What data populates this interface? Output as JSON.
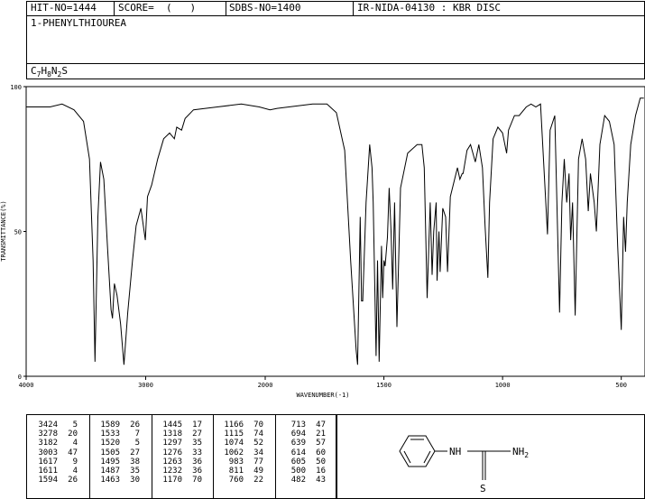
{
  "header": {
    "hit_no": "HIT-NO=1444",
    "score": "SCORE=  (   )",
    "sdbs_no": "SDBS-NO=1400",
    "ir_id": "IR-NIDA-04130 : KBR DISC",
    "compound_name": "1-PHENYLTHIOUREA",
    "formula": {
      "c": "C",
      "c_n": "7",
      "h": "H",
      "h_n": "8",
      "n": "N",
      "n_n": "2",
      "s": "S"
    }
  },
  "chart_data": {
    "type": "line",
    "xlabel": "WAVENUMBER(-1)",
    "ylabel": "TRANSMITTANCE(%)",
    "xlim": [
      4000,
      400
    ],
    "ylim": [
      0,
      100
    ],
    "x_ticks": [
      4000,
      3000,
      2000,
      1500,
      1000,
      500
    ],
    "y_ticks": [
      0,
      50,
      100
    ],
    "grid": false,
    "series": [
      {
        "points": [
          [
            4000,
            93
          ],
          [
            3800,
            93
          ],
          [
            3700,
            94
          ],
          [
            3600,
            92
          ],
          [
            3520,
            88
          ],
          [
            3470,
            75
          ],
          [
            3440,
            40
          ],
          [
            3424,
            5
          ],
          [
            3400,
            55
          ],
          [
            3378,
            74
          ],
          [
            3350,
            68
          ],
          [
            3320,
            45
          ],
          [
            3290,
            23
          ],
          [
            3278,
            20
          ],
          [
            3262,
            32
          ],
          [
            3240,
            28
          ],
          [
            3210,
            18
          ],
          [
            3182,
            4
          ],
          [
            3150,
            22
          ],
          [
            3110,
            40
          ],
          [
            3080,
            52
          ],
          [
            3040,
            58
          ],
          [
            3003,
            47
          ],
          [
            2985,
            62
          ],
          [
            2950,
            66
          ],
          [
            2900,
            75
          ],
          [
            2850,
            82
          ],
          [
            2800,
            84
          ],
          [
            2760,
            82
          ],
          [
            2740,
            86
          ],
          [
            2700,
            85
          ],
          [
            2670,
            89
          ],
          [
            2600,
            92
          ],
          [
            2400,
            93
          ],
          [
            2200,
            94
          ],
          [
            2050,
            93
          ],
          [
            1980,
            92
          ],
          [
            1950,
            92.5
          ],
          [
            1900,
            93
          ],
          [
            1800,
            94
          ],
          [
            1740,
            94
          ],
          [
            1700,
            91
          ],
          [
            1665,
            78
          ],
          [
            1640,
            40
          ],
          [
            1617,
            9
          ],
          [
            1611,
            4
          ],
          [
            1600,
            55
          ],
          [
            1594,
            26
          ],
          [
            1589,
            26
          ],
          [
            1575,
            60
          ],
          [
            1560,
            80
          ],
          [
            1550,
            72
          ],
          [
            1545,
            60
          ],
          [
            1533,
            7
          ],
          [
            1527,
            40
          ],
          [
            1520,
            5
          ],
          [
            1510,
            45
          ],
          [
            1505,
            27
          ],
          [
            1500,
            40
          ],
          [
            1495,
            38
          ],
          [
            1485,
            48
          ],
          [
            1478,
            65
          ],
          [
            1470,
            50
          ],
          [
            1463,
            30
          ],
          [
            1455,
            60
          ],
          [
            1445,
            17
          ],
          [
            1430,
            65
          ],
          [
            1400,
            77
          ],
          [
            1360,
            80
          ],
          [
            1340,
            80
          ],
          [
            1330,
            72
          ],
          [
            1318,
            27
          ],
          [
            1305,
            60
          ],
          [
            1297,
            35
          ],
          [
            1290,
            50
          ],
          [
            1280,
            60
          ],
          [
            1276,
            33
          ],
          [
            1268,
            50
          ],
          [
            1263,
            36
          ],
          [
            1252,
            58
          ],
          [
            1240,
            55
          ],
          [
            1232,
            36
          ],
          [
            1220,
            62
          ],
          [
            1190,
            72
          ],
          [
            1180,
            68
          ],
          [
            1170,
            70
          ],
          [
            1166,
            70
          ],
          [
            1150,
            78
          ],
          [
            1135,
            80
          ],
          [
            1115,
            74
          ],
          [
            1100,
            80
          ],
          [
            1085,
            72
          ],
          [
            1074,
            52
          ],
          [
            1062,
            34
          ],
          [
            1055,
            60
          ],
          [
            1040,
            82
          ],
          [
            1020,
            86
          ],
          [
            1000,
            84
          ],
          [
            983,
            77
          ],
          [
            975,
            85
          ],
          [
            950,
            90
          ],
          [
            930,
            90
          ],
          [
            900,
            93
          ],
          [
            880,
            94
          ],
          [
            860,
            93
          ],
          [
            840,
            94
          ],
          [
            811,
            49
          ],
          [
            800,
            85
          ],
          [
            780,
            90
          ],
          [
            760,
            22
          ],
          [
            750,
            60
          ],
          [
            740,
            75
          ],
          [
            730,
            60
          ],
          [
            720,
            70
          ],
          [
            713,
            47
          ],
          [
            705,
            60
          ],
          [
            694,
            21
          ],
          [
            680,
            75
          ],
          [
            665,
            82
          ],
          [
            650,
            75
          ],
          [
            639,
            57
          ],
          [
            630,
            70
          ],
          [
            614,
            60
          ],
          [
            605,
            50
          ],
          [
            590,
            80
          ],
          [
            570,
            90
          ],
          [
            550,
            88
          ],
          [
            530,
            80
          ],
          [
            515,
            45
          ],
          [
            500,
            16
          ],
          [
            490,
            55
          ],
          [
            482,
            43
          ],
          [
            475,
            60
          ],
          [
            460,
            80
          ],
          [
            440,
            90
          ],
          [
            420,
            96
          ],
          [
            405,
            96
          ]
        ]
      }
    ],
    "peaks": [
      [
        [
          3424,
          5
        ],
        [
          3278,
          20
        ],
        [
          3182,
          4
        ],
        [
          3003,
          47
        ],
        [
          1617,
          9
        ],
        [
          1611,
          4
        ],
        [
          1594,
          26
        ]
      ],
      [
        [
          1589,
          26
        ],
        [
          1533,
          7
        ],
        [
          1520,
          5
        ],
        [
          1505,
          27
        ],
        [
          1495,
          38
        ],
        [
          1487,
          35
        ],
        [
          1463,
          30
        ]
      ],
      [
        [
          1445,
          17
        ],
        [
          1318,
          27
        ],
        [
          1297,
          35
        ],
        [
          1276,
          33
        ],
        [
          1263,
          36
        ],
        [
          1232,
          36
        ],
        [
          1170,
          70
        ]
      ],
      [
        [
          1166,
          70
        ],
        [
          1115,
          74
        ],
        [
          1074,
          52
        ],
        [
          1062,
          34
        ],
        [
          983,
          77
        ],
        [
          811,
          49
        ],
        [
          760,
          22
        ]
      ],
      [
        [
          713,
          47
        ],
        [
          694,
          21
        ],
        [
          639,
          57
        ],
        [
          614,
          60
        ],
        [
          605,
          50
        ],
        [
          500,
          16
        ],
        [
          482,
          43
        ]
      ]
    ]
  },
  "structure": {
    "nh": "NH",
    "nh2_base": "NH",
    "nh2_sub": "2",
    "s": "S"
  }
}
